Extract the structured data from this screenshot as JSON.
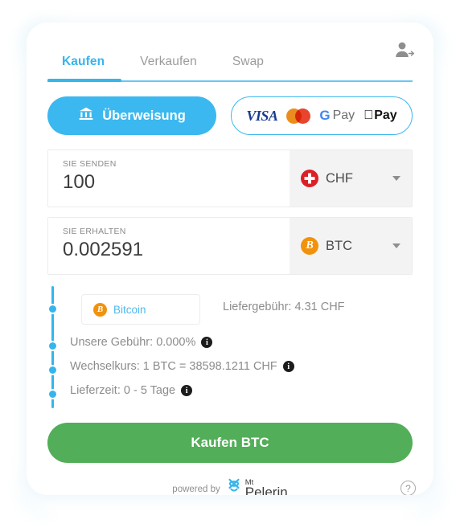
{
  "widget": {
    "login_icon": "person-add-icon"
  },
  "tabs": [
    {
      "label": "Kaufen",
      "active": true
    },
    {
      "label": "Verkaufen",
      "active": false
    },
    {
      "label": "Swap",
      "active": false
    }
  ],
  "payment": {
    "transfer_label": "Überweisung",
    "transfer_icon": "bank-icon",
    "cards": [
      {
        "name": "visa",
        "label": "VISA"
      },
      {
        "name": "mastercard",
        "label": ""
      },
      {
        "name": "google-pay",
        "label": "Pay",
        "mark": "G"
      },
      {
        "name": "apple-pay",
        "label": "Pay",
        "mark": ""
      }
    ]
  },
  "send": {
    "caption": "SIE SENDEN",
    "value": "100",
    "currency": "CHF",
    "currency_icon": "swiss-flag-icon"
  },
  "receive": {
    "caption": "SIE ERHALTEN",
    "value": "0.002591",
    "currency": "BTC",
    "currency_icon": "bitcoin-icon"
  },
  "details": {
    "network": "Bitcoin",
    "delivery_fee": "Liefergebühr: 4.31 CHF",
    "rows": [
      {
        "text": "Unsere Gebühr: 0.000%",
        "info": "i"
      },
      {
        "text": "Wechselkurs: 1 BTC = 38598.1211 CHF",
        "info": "i"
      },
      {
        "text": "Lieferzeit: 0 - 5 Tage",
        "info": "i"
      }
    ]
  },
  "cta": {
    "label": "Kaufen BTC"
  },
  "footer": {
    "powered_by": "powered by",
    "brand_top": "Mt",
    "brand_bottom": "Pelerin",
    "help": "?"
  },
  "colors": {
    "accent": "#35b5ec",
    "cta_green": "#52ae58",
    "bitcoin_orange": "#f2920c",
    "swiss_red": "#dd1f26"
  }
}
